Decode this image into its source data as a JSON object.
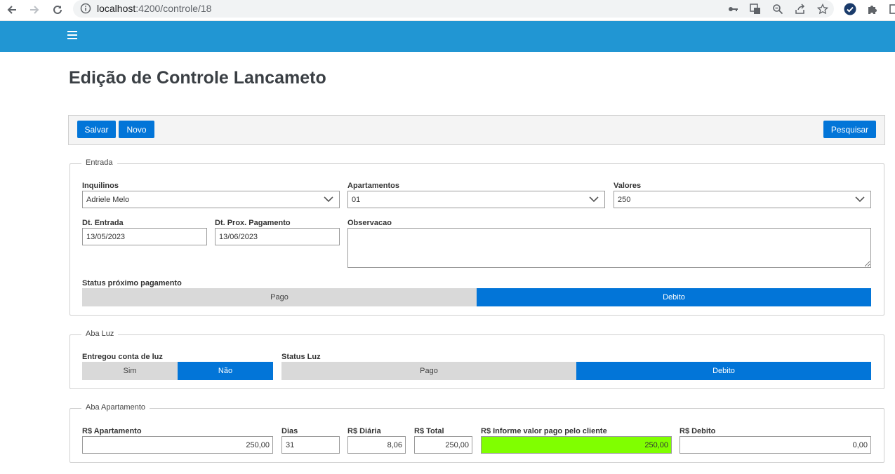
{
  "browser": {
    "url_host": "localhost",
    "url_path": ":4200/controle/18"
  },
  "page": {
    "title": "Edição de Controle Lancameto"
  },
  "toolbar": {
    "save_label": "Salvar",
    "new_label": "Novo",
    "search_label": "Pesquisar"
  },
  "entrada": {
    "legend": "Entrada",
    "inquilinos_label": "Inquilinos",
    "inquilinos_value": "Adriele Melo",
    "apartamentos_label": "Apartamentos",
    "apartamentos_value": "01",
    "valores_label": "Valores",
    "valores_value": "250",
    "dt_entrada_label": "Dt. Entrada",
    "dt_entrada_value": "13/05/2023",
    "dt_prox_label": "Dt. Prox. Pagamento",
    "dt_prox_value": "13/06/2023",
    "observacao_label": "Observacao",
    "status_label": "Status próximo pagamento",
    "status_options": [
      "Pago",
      "Debito"
    ],
    "status_selected": "Debito"
  },
  "luz": {
    "legend": "Aba Luz",
    "entregou_label": "Entregou conta de luz",
    "entregou_options": [
      "Sim",
      "Não"
    ],
    "entregou_selected": "Não",
    "status_label": "Status Luz",
    "status_options": [
      "Pago",
      "Debito"
    ],
    "status_selected": "Debito"
  },
  "apartamento": {
    "legend": "Aba Apartamento",
    "valor_apto_label": "R$ Apartamento",
    "valor_apto_value": "250,00",
    "dias_label": "Dias",
    "dias_value": "31",
    "diaria_label": "R$ Diária",
    "diaria_value": "8,06",
    "total_label": "R$ Total",
    "total_value": "250,00",
    "pago_label": "R$ Informe valor pago pelo cliente",
    "pago_value": "250,00",
    "debito_label": "R$ Debito",
    "debito_value": "0,00"
  },
  "colors": {
    "topbar": "#2196d3",
    "primary": "#0275d8",
    "paid_highlight": "#80ff00"
  }
}
